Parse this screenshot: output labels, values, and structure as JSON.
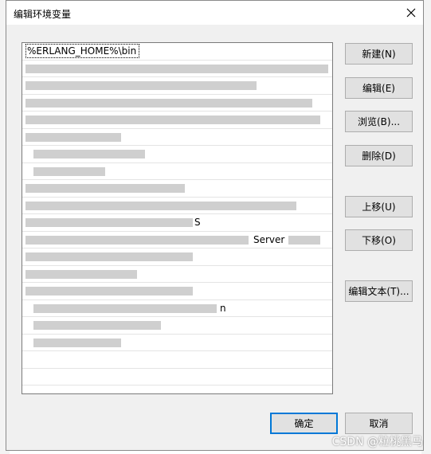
{
  "dialog": {
    "title": "编辑环境变量",
    "close_icon": "close-icon"
  },
  "list": {
    "selected_value": "%ERLANG_HOME%\\bin",
    "visible_fragments": {
      "row10": "S",
      "row11": "Server",
      "row15": "n"
    }
  },
  "buttons": {
    "new": "新建(N)",
    "edit": "编辑(E)",
    "browse": "浏览(B)...",
    "delete": "删除(D)",
    "move_up": "上移(U)",
    "move_down": "下移(O)",
    "edit_text": "编辑文本(T)...",
    "ok": "确定",
    "cancel": "取消"
  },
  "watermark": "CSDN @粒桃黑马"
}
